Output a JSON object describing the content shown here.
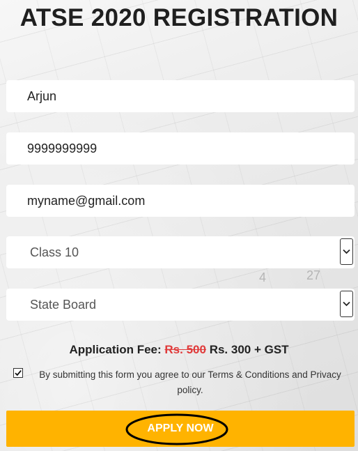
{
  "title": "ATSE 2020 REGISTRATION",
  "form": {
    "name_value": "Arjun",
    "phone_value": "9999999999",
    "email_value": "myname@gmail.com",
    "class_selected": "Class 10",
    "board_selected": "State Board"
  },
  "fee": {
    "label": "Application Fee:",
    "old_price": "Rs. 500",
    "new_price": "Rs. 300 + GST"
  },
  "agreement": {
    "checked": true,
    "text": "By submitting this form you agree to our Terms & Conditions and Privacy policy."
  },
  "apply_button": {
    "label": "APPLY NOW",
    "color": "#ffb300"
  },
  "annotation": {
    "shape": "ellipse",
    "color": "#000000"
  },
  "background_numbers": [
    "4",
    "27"
  ],
  "icons": {
    "select_arrow": "chevron-down-icon",
    "checkbox": "checkmark-icon"
  }
}
